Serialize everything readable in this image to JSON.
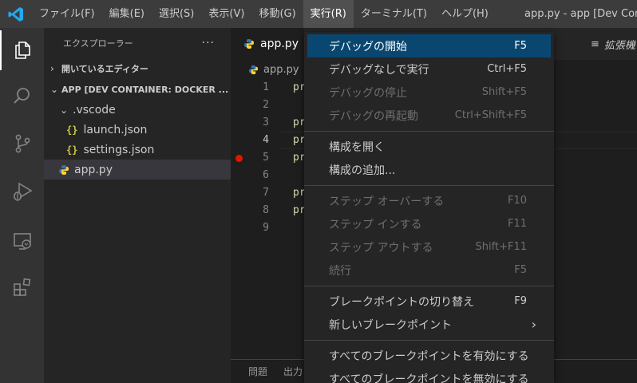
{
  "menubar": {
    "items": [
      "ファイル(F)",
      "編集(E)",
      "選択(S)",
      "表示(V)",
      "移動(G)",
      "実行(R)",
      "ターミナル(T)",
      "ヘルプ(H)"
    ],
    "active_index": 5,
    "window_title": "app.py - app [Dev Conta"
  },
  "activity_icons": [
    "explorer-icon",
    "search-icon",
    "source-control-icon",
    "run-debug-icon",
    "remote-explorer-icon",
    "extensions-icon"
  ],
  "sidebar": {
    "title": "エクスプローラー",
    "more": "···",
    "open_editors": "開いているエディター",
    "workspace": "APP [DEV CONTAINER: DOCKER ...",
    "tree": [
      {
        "label": ".vscode",
        "type": "folder"
      },
      {
        "label": "launch.json",
        "type": "json"
      },
      {
        "label": "settings.json",
        "type": "json"
      },
      {
        "label": "app.py",
        "type": "python"
      }
    ]
  },
  "editor": {
    "tab_label": "app.py",
    "tab_right": "拡張機",
    "breadcrumb": "app.py",
    "lines": [
      {
        "num": "1",
        "text": "pr"
      },
      {
        "num": "2",
        "text": ""
      },
      {
        "num": "3",
        "text": "pr"
      },
      {
        "num": "4",
        "text": "pr"
      },
      {
        "num": "5",
        "text": "pr"
      },
      {
        "num": "6",
        "text": ""
      },
      {
        "num": "7",
        "text": "pr"
      },
      {
        "num": "8",
        "text": "pr"
      },
      {
        "num": "9",
        "text": ""
      }
    ],
    "breakpoint_line": "5",
    "current_line": "4",
    "panel_tabs": [
      "問題",
      "出力"
    ]
  },
  "run_menu": {
    "items": [
      {
        "label": "デバッグの開始",
        "key": "F5",
        "state": "highlight"
      },
      {
        "label": "デバッグなしで実行",
        "key": "Ctrl+F5",
        "state": "enabled"
      },
      {
        "label": "デバッグの停止",
        "key": "Shift+F5",
        "state": "disabled"
      },
      {
        "label": "デバッグの再起動",
        "key": "Ctrl+Shift+F5",
        "state": "disabled"
      },
      {
        "label": "構成を開く",
        "key": "",
        "state": "enabled"
      },
      {
        "label": "構成の追加...",
        "key": "",
        "state": "enabled"
      },
      {
        "label": "ステップ オーバーする",
        "key": "F10",
        "state": "disabled"
      },
      {
        "label": "ステップ インする",
        "key": "F11",
        "state": "disabled"
      },
      {
        "label": "ステップ アウトする",
        "key": "Shift+F11",
        "state": "disabled"
      },
      {
        "label": "続行",
        "key": "F5",
        "state": "disabled"
      },
      {
        "label": "ブレークポイントの切り替え",
        "key": "F9",
        "state": "enabled"
      },
      {
        "label": "新しいブレークポイント",
        "key": "›",
        "state": "submenu"
      },
      {
        "label": "すべてのブレークポイントを有効にする",
        "key": "",
        "state": "enabled"
      },
      {
        "label": "すべてのブレークポイントを無効にする",
        "key": "",
        "state": "enabled"
      }
    ]
  },
  "colors": {
    "accent": "#007acc",
    "highlight": "#094771",
    "breakpoint": "#e51400",
    "json_icon": "#cbcb41",
    "python_blue": "#3572a5",
    "python_yellow": "#ffd43b"
  }
}
